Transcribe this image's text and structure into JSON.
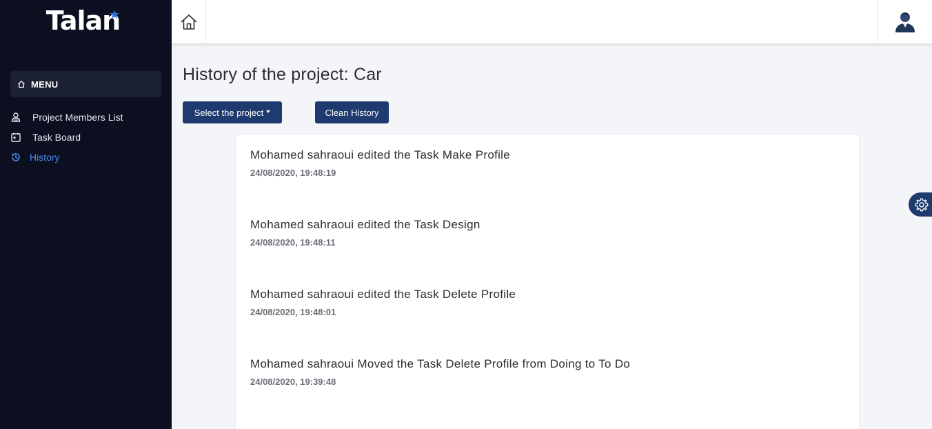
{
  "app": {
    "logo_text": "Talan"
  },
  "sidebar": {
    "menu_label": "MENU",
    "items": [
      {
        "label": "Project Members List",
        "icon": "members-icon",
        "active": false
      },
      {
        "label": "Task Board",
        "icon": "board-icon",
        "active": false
      },
      {
        "label": "History",
        "icon": "history-icon",
        "active": true
      }
    ]
  },
  "topbar": {
    "home_icon": "home-icon",
    "user_icon": "user-avatar"
  },
  "main": {
    "title": "History of the project: Car",
    "select_button_label": "Select the project",
    "clean_button_label": "Clean History",
    "history": [
      {
        "text": "Mohamed sahraoui edited the Task Make Profile",
        "time": "24/08/2020, 19:48:19"
      },
      {
        "text": "Mohamed sahraoui edited the Task Design",
        "time": "24/08/2020, 19:48:11"
      },
      {
        "text": "Mohamed sahraoui edited the Task Delete Profile",
        "time": "24/08/2020, 19:48:01"
      },
      {
        "text": "Mohamed sahraoui Moved the Task Delete Profile from Doing to To Do",
        "time": "24/08/2020, 19:39:48"
      }
    ]
  },
  "colors": {
    "sidebar_bg": "#0b0f1f",
    "accent": "#1e3a6e",
    "active_link": "#4d8af0",
    "page_bg": "#f4f5f8"
  }
}
